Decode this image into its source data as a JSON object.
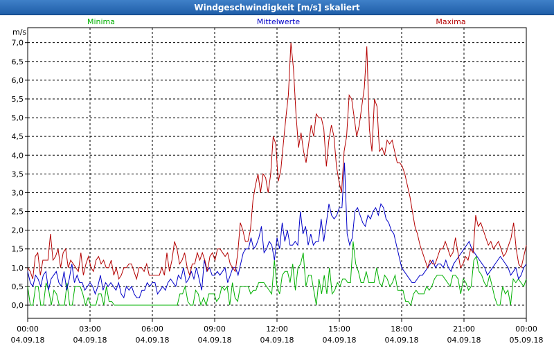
{
  "window": {
    "title": "Windgeschwindigkeit [m/s] skaliert"
  },
  "chart_data": {
    "type": "line",
    "title": "Windgeschwindigkeit [m/s] skaliert",
    "ylabel": "m/s",
    "ylim": [
      -0.35,
      7.4
    ],
    "yticks": [
      "0,0",
      "0,5",
      "1,0",
      "1,5",
      "2,0",
      "2,5",
      "3,0",
      "3,5",
      "4,0",
      "4,5",
      "5,0",
      "5,5",
      "6,0",
      "6,5",
      "7,0"
    ],
    "xticks": [
      {
        "time": "00:00",
        "date": "04.09.18"
      },
      {
        "time": "03:00",
        "date": "04.09.18"
      },
      {
        "time": "06:00",
        "date": "04.09.18"
      },
      {
        "time": "09:00",
        "date": "04.09.18"
      },
      {
        "time": "12:00",
        "date": "04.09.18"
      },
      {
        "time": "15:00",
        "date": "04.09.18"
      },
      {
        "time": "18:00",
        "date": "04.09.18"
      },
      {
        "time": "21:00",
        "date": "04.09.18"
      },
      {
        "time": "00:00",
        "date": "05.09.18"
      }
    ],
    "x_range_hours": [
      0,
      24
    ],
    "grid": true,
    "series": [
      {
        "name": "Minima",
        "color": "#00b000",
        "values": [
          0.5,
          0,
          0,
          0.5,
          0.5,
          0,
          0,
          0.6,
          0.4,
          0,
          0.4,
          0.3,
          0,
          0,
          0,
          0.6,
          0,
          0,
          0.5,
          0.5,
          0.5,
          0.3,
          0,
          0.2,
          0,
          0,
          0,
          0.3,
          0.3,
          0,
          0.5,
          0.1,
          0.1,
          0,
          0,
          0,
          0,
          0,
          0,
          0,
          0,
          0,
          0,
          0,
          0,
          0,
          0,
          0,
          0,
          0,
          0,
          0,
          0,
          0,
          0,
          0,
          0,
          0,
          0.3,
          0.3,
          0.5,
          0.1,
          0,
          0,
          0.4,
          0.3,
          0,
          0.2,
          0,
          0.3,
          0.3,
          0.3,
          0.1,
          0.2,
          0.5,
          0.4,
          0.5,
          0,
          0.6,
          0.2,
          0.1,
          0.5,
          0.5,
          0.5,
          0.5,
          0.3,
          0.4,
          0.4,
          0.6,
          0.6,
          0.6,
          0.5,
          0.4,
          0.3,
          1.2,
          0.5,
          0.3,
          0.8,
          0.9,
          0.9,
          0.6,
          1.1,
          0.4,
          1.0,
          1.1,
          1.4,
          0.5,
          0.8,
          0.8,
          0.4,
          0,
          0.7,
          0.3,
          0.8,
          0.3,
          1.0,
          0.3,
          0.4,
          0.6,
          0.5,
          0.7,
          0.7,
          0.6,
          0.6,
          1.7,
          1.1,
          0.9,
          0.6,
          0.6,
          0.9,
          0.6,
          0.6,
          0.6,
          1.0,
          0.6,
          0.5,
          0.8,
          0.7,
          0.5,
          0.6,
          0.8,
          0.4,
          0.4,
          0.4,
          0.1,
          0.1,
          0.0,
          0.3,
          0.4,
          0.3,
          0.3,
          0.3,
          0.5,
          0.4,
          0.5,
          0.7,
          0.8,
          0.8,
          0.8,
          0.7,
          0.6,
          0.5,
          0.8,
          0.8,
          0.7,
          0.3,
          0.7,
          0.6,
          0.4,
          0.5,
          1.2,
          1.3,
          0.9,
          0.8,
          0.6,
          0.5,
          0.8,
          0.5,
          0.2,
          0,
          0,
          0.5,
          0.3,
          0.4,
          0.0,
          0.7,
          0.6,
          0.7,
          0.6,
          0.5,
          0.7
        ]
      },
      {
        "name": "Mittelwerte",
        "color": "#0000c8",
        "values": [
          0.9,
          0.6,
          0.5,
          0.8,
          0.7,
          0.5,
          0.8,
          0.9,
          0.4,
          0.7,
          0.8,
          0.9,
          0.6,
          0.5,
          0.9,
          0.4,
          0.7,
          1.1,
          0.6,
          0.8,
          0.6,
          0.6,
          0.4,
          0.5,
          0.6,
          0.5,
          0.3,
          0.5,
          0.8,
          0.4,
          0.6,
          0.5,
          0.6,
          0.5,
          0.4,
          0.6,
          0.3,
          0.2,
          0.5,
          0.4,
          0.5,
          0.3,
          0.2,
          0.2,
          0.4,
          0.4,
          0.6,
          0.5,
          0.6,
          0.6,
          0.3,
          0.4,
          0.5,
          0.4,
          0.6,
          0.7,
          0.6,
          0.5,
          0.8,
          0.7,
          1.0,
          0.6,
          0.7,
          0.9,
          0.7,
          1.0,
          0.7,
          0.4,
          1.2,
          0.9,
          1.0,
          0.8,
          0.8,
          0.9,
          0.8,
          0.9,
          1.0,
          0.6,
          0.8,
          1.0,
          1.0,
          0.8,
          1.1,
          1.4,
          1.5,
          1.5,
          1.8,
          1.5,
          1.6,
          1.8,
          2.1,
          1.4,
          1.5,
          1.7,
          1.6,
          1.2,
          1.8,
          1.5,
          2.2,
          1.7,
          2.0,
          1.6,
          1.6,
          1.7,
          1.6,
          2.5,
          1.9,
          2.1,
          1.6,
          1.9,
          1.6,
          1.7,
          1.7,
          2.3,
          1.7,
          2.2,
          2.7,
          2.4,
          2.3,
          2.4,
          2.6,
          2.6,
          3.8,
          1.9,
          1.6,
          1.8,
          2.5,
          2.6,
          2.4,
          2.2,
          2.1,
          2.4,
          2.3,
          2.5,
          2.6,
          2.4,
          2.7,
          2.6,
          2.3,
          2.2,
          2.0,
          1.9,
          1.6,
          1.3,
          1.0,
          0.9,
          0.8,
          0.7,
          0.6,
          0.6,
          0.7,
          0.8,
          0.8,
          0.9,
          1.0,
          1.1,
          1.2,
          1.0,
          1.1,
          1.1,
          1.0,
          1.2,
          1.0,
          0.9,
          1.1,
          1.2,
          1.3,
          1.4,
          1.5,
          1.6,
          1.7,
          1.5,
          1.4,
          1.3,
          1.2,
          1.1,
          1.0,
          0.8,
          0.9,
          1.0,
          1.1,
          1.2,
          1.3,
          1.2,
          1.1,
          1.0,
          0.8,
          0.9,
          1.0,
          0.7,
          0.8,
          1.0,
          1.1
        ]
      },
      {
        "name": "Maxima",
        "color": "#b40000",
        "values": [
          1.0,
          0.9,
          0.7,
          1.3,
          1.4,
          0.8,
          1.2,
          1.2,
          1.2,
          1.9,
          1.2,
          1.3,
          1.5,
          1.0,
          1.4,
          1.5,
          1.0,
          1.2,
          1.1,
          1.0,
          0.9,
          1.4,
          0.8,
          1.1,
          1.3,
          1.0,
          0.9,
          1.2,
          1.3,
          1.1,
          1.2,
          1.0,
          1.0,
          1.2,
          0.8,
          1.0,
          0.7,
          0.8,
          1.0,
          1.0,
          1.1,
          1.1,
          0.9,
          0.7,
          1.0,
          1.0,
          0.9,
          1.1,
          0.8,
          0.8,
          0.8,
          0.8,
          0.8,
          1.0,
          0.8,
          1.4,
          0.9,
          1.2,
          1.7,
          1.5,
          1.1,
          1.2,
          1.4,
          1.0,
          0.8,
          1.1,
          1.1,
          1.4,
          1.2,
          1.4,
          1.2,
          0.9,
          1.3,
          1.4,
          1.2,
          1.5,
          1.5,
          1.4,
          1.3,
          1.4,
          1.1,
          1.0,
          0.9,
          1.4,
          2.2,
          2.0,
          1.7,
          1.7,
          2.0,
          2.8,
          3.2,
          3.5,
          3.0,
          3.5,
          3.4,
          3.0,
          3.5,
          4.5,
          4.3,
          3.3,
          3.6,
          4.3,
          5.0,
          5.6,
          7.0,
          6.3,
          5.1,
          4.2,
          4.6,
          4.1,
          3.8,
          4.3,
          4.8,
          4.5,
          5.1,
          5.0,
          5.0,
          4.7,
          3.7,
          4.4,
          4.8,
          4.5,
          3.7,
          3.3,
          3.0,
          4.1,
          4.5,
          5.6,
          5.5,
          5.0,
          4.5,
          4.8,
          5.3,
          5.8,
          6.9,
          4.7,
          4.1,
          5.5,
          5.3,
          4.1,
          4.2,
          4.0,
          4.4,
          4.3,
          4.4,
          4.1,
          3.8,
          3.8,
          3.7,
          3.5,
          3.2,
          2.9,
          2.5,
          2.1,
          1.9,
          1.6,
          1.4,
          1.2,
          1.0,
          1.2,
          1.1,
          1.1,
          1.3,
          1.5,
          1.5,
          1.7,
          1.5,
          1.3,
          1.4,
          1.8,
          1.4,
          1.0,
          1.1,
          1.3,
          1.2,
          1.5,
          1.4,
          2.4,
          2.1,
          2.2,
          2.0,
          1.8,
          1.6,
          1.7,
          1.5,
          1.6,
          1.7,
          1.5,
          1.3,
          1.4,
          1.6,
          1.8,
          2.2,
          1.5,
          1.1,
          1.0,
          1.3,
          1.6
        ]
      }
    ]
  }
}
